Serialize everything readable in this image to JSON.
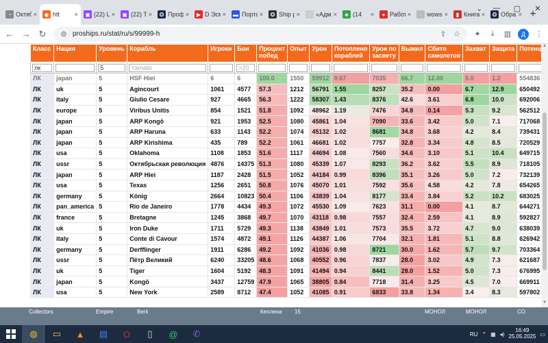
{
  "browser": {
    "tabs": [
      {
        "label": "Октяб",
        "color": "#888888",
        "glyph": "◔",
        "active": false
      },
      {
        "label": "htt",
        "color": "#f26b1d",
        "glyph": "◉",
        "active": true
      },
      {
        "label": "(22) Li",
        "color": "#9146ff",
        "glyph": "▣",
        "active": false
      },
      {
        "label": "(22) T",
        "color": "#9146ff",
        "glyph": "▣",
        "active": false
      },
      {
        "label": "Профі",
        "color": "#1b2a4a",
        "glyph": "✪",
        "active": false
      },
      {
        "label": "D Эсм",
        "color": "#e22b2b",
        "glyph": "▶",
        "active": false
      },
      {
        "label": "Порта",
        "color": "#2a5bd7",
        "glyph": "▬",
        "active": false
      },
      {
        "label": "Ship p",
        "color": "#333333",
        "glyph": "✪",
        "active": false
      },
      {
        "label": "«Адм",
        "color": "#cccccc",
        "glyph": "◌",
        "active": false
      },
      {
        "label": "(14",
        "color": "#2aa84a",
        "glyph": "♣",
        "active": false
      },
      {
        "label": "Работ",
        "color": "#e22b2b",
        "glyph": "●",
        "active": false
      },
      {
        "label": "wows",
        "color": "#bbbbbb",
        "glyph": "◌",
        "active": false
      },
      {
        "label": "Книга",
        "color": "#c0392b",
        "glyph": "▮",
        "active": false
      },
      {
        "label": "Обра",
        "color": "#1b2a4a",
        "glyph": "✪",
        "active": false
      }
    ],
    "tab_close": "×",
    "new_tab": "+",
    "url": "proships.ru/stat/ru/s/99999-h",
    "profile_initial": "Д",
    "window_controls": {
      "search": "⌄",
      "minimize": "—",
      "maximize": "▢",
      "close": "✕"
    }
  },
  "table": {
    "headers": [
      "Класс",
      "Нация",
      "Уровень",
      "Корабль",
      "Игроки",
      "Бои",
      "Процент побед",
      "Опыт",
      "Урон",
      "Потоплено кораблей",
      "Урон по засвету",
      "Выжил",
      "Сбито самолетов",
      "Захват",
      "Защита",
      "Потенци"
    ],
    "filters": [
      {
        "text": "лк",
        "placeholder": false
      },
      {
        "text": "",
        "placeholder": false
      },
      {
        "text": "5",
        "placeholder": false
      },
      {
        "text": "Yamato",
        "placeholder": true
      },
      {
        "text": "",
        "placeholder": false
      },
      {
        "text": ">20",
        "placeholder": true
      },
      {
        "text": "",
        "placeholder": false
      },
      {
        "text": "",
        "placeholder": false
      },
      {
        "text": "",
        "placeholder": false
      },
      {
        "text": "",
        "placeholder": false
      },
      {
        "text": "",
        "placeholder": false
      },
      {
        "text": "",
        "placeholder": false
      },
      {
        "text": "",
        "placeholder": false
      },
      {
        "text": "",
        "placeholder": false
      },
      {
        "text": "",
        "placeholder": false
      },
      {
        "text": "",
        "placeholder": false
      }
    ],
    "rows": [
      [
        "ЛК",
        "japan",
        "5",
        "HSF Hiei",
        "6",
        "6",
        "100.0",
        "1550",
        "59912",
        "0.67",
        "7035",
        "66.7",
        "12.00",
        "0.0",
        "1.2",
        "554836"
      ],
      [
        "ЛК",
        "uk",
        "5",
        "Agincourt",
        "1061",
        "4577",
        "57.3",
        "1212",
        "56791",
        "1.55",
        "8257",
        "35.2",
        "0.00",
        "6.7",
        "12.9",
        "650492"
      ],
      [
        "ЛК",
        "italy",
        "5",
        "Giulio Cesare",
        "927",
        "4665",
        "56.3",
        "1222",
        "58307",
        "1.43",
        "8376",
        "42.6",
        "3.61",
        "6.8",
        "10.0",
        "692006"
      ],
      [
        "ЛК",
        "europe",
        "5",
        "Viribus Unitis",
        "854",
        "1521",
        "51.8",
        "1092",
        "48962",
        "1.19",
        "7476",
        "34.8",
        "0.14",
        "5.3",
        "9.2",
        "562512"
      ],
      [
        "ЛК",
        "japan",
        "5",
        "ARP Kongō",
        "921",
        "1953",
        "52.5",
        "1080",
        "45861",
        "1.04",
        "7090",
        "33.6",
        "3.42",
        "5.0",
        "7.1",
        "717068"
      ],
      [
        "ЛК",
        "japan",
        "5",
        "ARP Haruna",
        "633",
        "1143",
        "52.2",
        "1074",
        "45132",
        "1.02",
        "8681",
        "34.8",
        "3.68",
        "4.2",
        "8.4",
        "739431"
      ],
      [
        "ЛК",
        "japan",
        "5",
        "ARP Kirishima",
        "435",
        "789",
        "52.2",
        "1061",
        "46681",
        "1.02",
        "7757",
        "32.8",
        "3.34",
        "4.8",
        "8.5",
        "720529"
      ],
      [
        "ЛК",
        "usa",
        "5",
        "Oklahoma",
        "1108",
        "1853",
        "51.6",
        "1117",
        "44694",
        "1.08",
        "7560",
        "34.6",
        "3.10",
        "5.1",
        "10.4",
        "649715"
      ],
      [
        "ЛК",
        "ussr",
        "5",
        "Октябрьская революция",
        "4876",
        "14375",
        "51.3",
        "1080",
        "45339",
        "1.07",
        "8293",
        "36.2",
        "3.62",
        "5.5",
        "8.9",
        "718105"
      ],
      [
        "ЛК",
        "japan",
        "5",
        "ARP Hiei",
        "1187",
        "2428",
        "51.5",
        "1052",
        "44184",
        "0.99",
        "8396",
        "35.1",
        "3.26",
        "5.0",
        "7.2",
        "732139"
      ],
      [
        "ЛК",
        "usa",
        "5",
        "Texas",
        "1256",
        "2651",
        "50.8",
        "1076",
        "45070",
        "1.01",
        "7592",
        "35.6",
        "4.58",
        "4.2",
        "7.8",
        "654265"
      ],
      [
        "ЛК",
        "germany",
        "5",
        "König",
        "2664",
        "10823",
        "50.4",
        "1106",
        "43839",
        "1.04",
        "8177",
        "33.4",
        "3.84",
        "5.2",
        "10.2",
        "683025"
      ],
      [
        "ЛК",
        "pan_america",
        "5",
        "Rio de Janeiro",
        "1778",
        "4434",
        "49.3",
        "1072",
        "45530",
        "1.09",
        "7623",
        "31.1",
        "0.00",
        "4.1",
        "8.7",
        "644271"
      ],
      [
        "ЛК",
        "france",
        "5",
        "Bretagne",
        "1245",
        "3868",
        "49.7",
        "1070",
        "43118",
        "0.98",
        "7557",
        "32.4",
        "2.59",
        "4.1",
        "8.9",
        "592827"
      ],
      [
        "ЛК",
        "uk",
        "5",
        "Iron Duke",
        "1711",
        "5729",
        "49.3",
        "1138",
        "43849",
        "1.01",
        "7573",
        "35.5",
        "3.72",
        "4.7",
        "9.0",
        "638039"
      ],
      [
        "ЛК",
        "italy",
        "5",
        "Conte di Cavour",
        "1574",
        "4872",
        "49.1",
        "1126",
        "44387",
        "1.06",
        "7704",
        "32.1",
        "1.81",
        "5.1",
        "8.8",
        "626942"
      ],
      [
        "ЛК",
        "germany",
        "5",
        "Derfflinger",
        "1911",
        "6286",
        "49.2",
        "1092",
        "41036",
        "0.98",
        "8721",
        "30.0",
        "1.62",
        "5.7",
        "9.7",
        "703364"
      ],
      [
        "ЛК",
        "ussr",
        "5",
        "Пётр Великий",
        "6240",
        "33205",
        "48.6",
        "1068",
        "40552",
        "0.96",
        "7837",
        "28.0",
        "3.02",
        "4.9",
        "7.3",
        "621687"
      ],
      [
        "ЛК",
        "uk",
        "5",
        "Tiger",
        "1604",
        "5192",
        "48.3",
        "1091",
        "41494",
        "0.94",
        "8441",
        "28.0",
        "1.52",
        "5.0",
        "7.3",
        "676995"
      ],
      [
        "ЛК",
        "japan",
        "5",
        "Kongō",
        "3437",
        "12759",
        "47.9",
        "1065",
        "38805",
        "0.84",
        "7718",
        "31.4",
        "3.25",
        "4.5",
        "7.0",
        "669911"
      ],
      [
        "ЛК",
        "usa",
        "5",
        "New York",
        "2589",
        "8712",
        "47.4",
        "1052",
        "41085",
        "0.91",
        "6833",
        "33.8",
        "1.34",
        "3.4",
        "8.3",
        "597802"
      ]
    ],
    "colored_columns": [
      6,
      8,
      9,
      10,
      11,
      12,
      13,
      14
    ],
    "low_color": "#f4a0a0",
    "mid_color": "#fbeeee",
    "high_color": "#9ed79e"
  },
  "desktop_labels": [
    "Collectors",
    "Empire",
    "Berli",
    "Кеплена",
    "15",
    "МОНОЛ",
    "МОНОЛ",
    "CO"
  ],
  "taskbar": {
    "apps": [
      {
        "name": "chrome",
        "glyph": "◍",
        "color": "#f4c20d",
        "active": true
      },
      {
        "name": "explorer",
        "glyph": "▭",
        "color": "#f2c14e",
        "active": false
      },
      {
        "name": "vlc",
        "glyph": "▲",
        "color": "#f28c1e",
        "active": false
      },
      {
        "name": "files",
        "glyph": "▤",
        "color": "#3b82f6",
        "active": false
      },
      {
        "name": "opera",
        "glyph": "O",
        "color": "#e0262a",
        "active": false
      },
      {
        "name": "notepad",
        "glyph": "▯",
        "color": "#dddddd",
        "active": false
      },
      {
        "name": "email",
        "glyph": "@",
        "color": "#2ecc71",
        "active": false
      },
      {
        "name": "viber",
        "glyph": "✆",
        "color": "#7b61ff",
        "active": false
      }
    ],
    "lang": "RU",
    "time": "16:49",
    "date": "25.05.2025"
  }
}
